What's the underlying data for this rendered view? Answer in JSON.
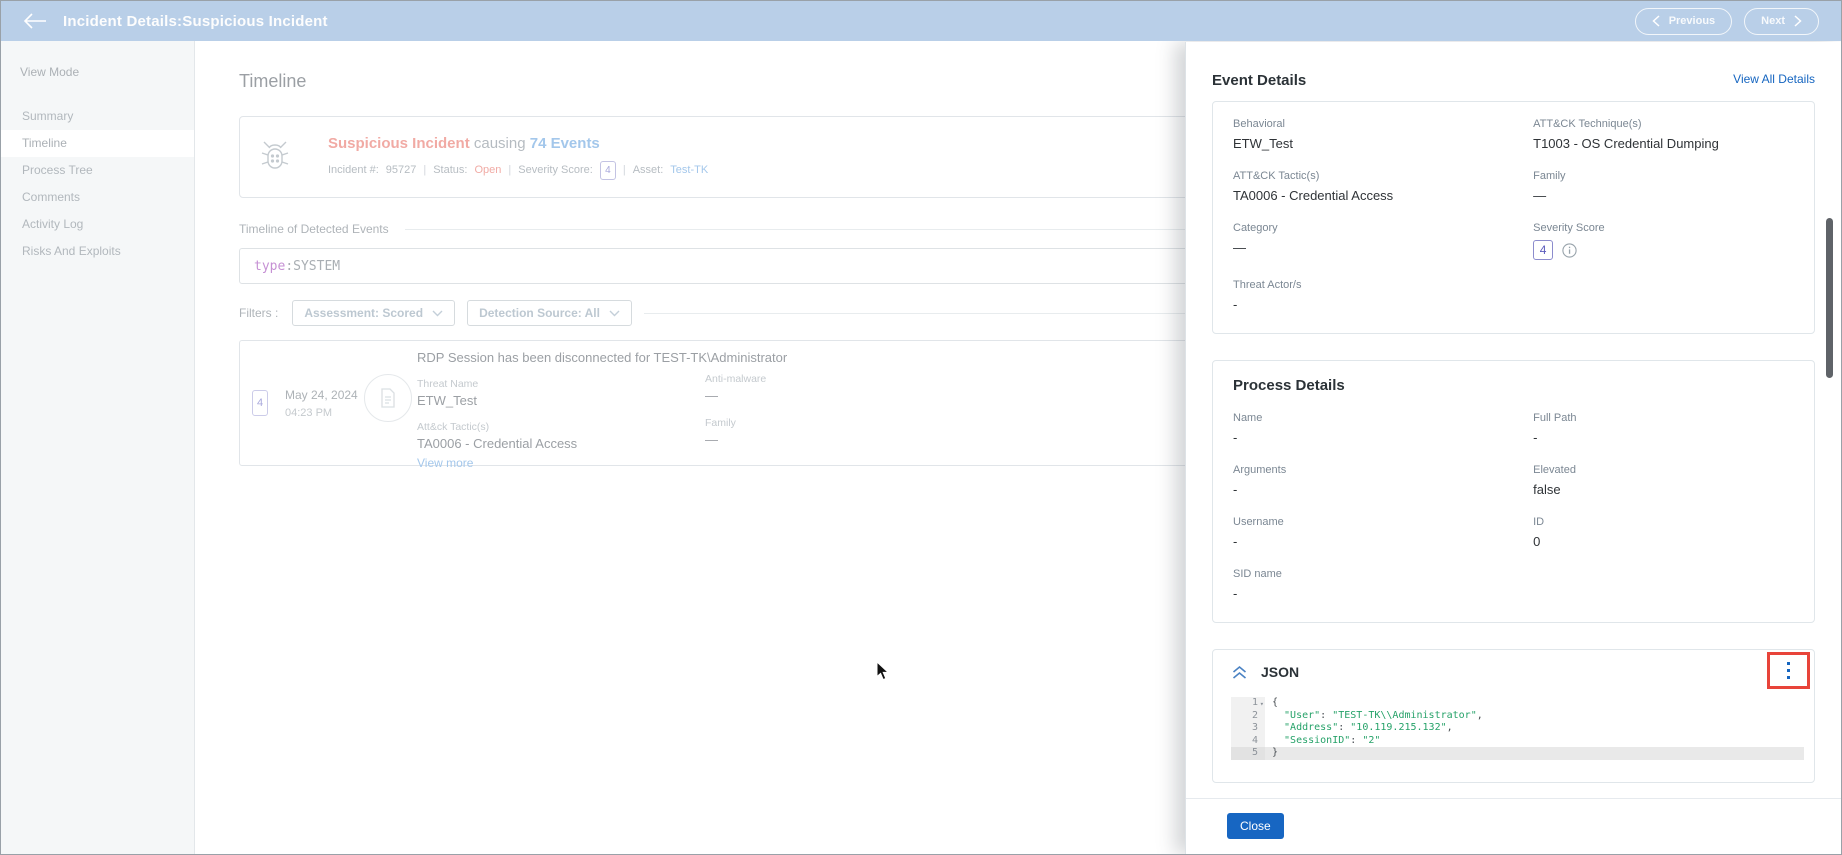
{
  "header": {
    "title": "Incident Details:Suspicious Incident",
    "previous_label": "Previous",
    "next_label": "Next"
  },
  "sidebar": {
    "title": "View Mode",
    "items": [
      {
        "label": "Summary"
      },
      {
        "label": "Timeline"
      },
      {
        "label": "Process Tree"
      },
      {
        "label": "Comments"
      },
      {
        "label": "Activity Log"
      },
      {
        "label": "Risks And Exploits"
      }
    ]
  },
  "main": {
    "page_title": "Timeline",
    "incident_card": {
      "name": "Suspicious Incident",
      "connector": " causing ",
      "events": "74 Events",
      "incident_label": "Incident #:",
      "incident_value": "95727",
      "status_label": "Status:",
      "status_value": "Open",
      "severity_label": "Severity Score:",
      "severity_value": "4",
      "asset_label": "Asset:",
      "asset_value": "Test-TK",
      "separator": "|"
    },
    "section_label": "Timeline of Detected Events",
    "search": {
      "key": "type",
      "rest": ":SYSTEM"
    },
    "filters": {
      "label": "Filters :",
      "assessment": "Assessment: Scored",
      "detection_source": "Detection Source: All"
    },
    "event_card": {
      "severity": "4",
      "date": "May 24, 2024",
      "time": "04:23 PM",
      "title": "RDP Session has been disconnected for TEST-TK\\Administrator",
      "threat_name_label": "Threat Name",
      "threat_name": "ETW_Test",
      "tactic_label": "Att&ck Tactic(s)",
      "tactic": "TA0006 - Credential Access",
      "view_more": "View more",
      "antimalware_label": "Anti-malware",
      "antimalware": "—",
      "family_label": "Family",
      "family": "—"
    }
  },
  "panel": {
    "title": "Event Details",
    "view_all_label": "View All Details",
    "event_details": {
      "behavioral_label": "Behavioral",
      "behavioral": "ETW_Test",
      "technique_label": "ATT&CK Technique(s)",
      "technique": "T1003 - OS Credential Dumping",
      "tactic_label": "ATT&CK Tactic(s)",
      "tactic": "TA0006 - Credential Access",
      "family_label": "Family",
      "family": "—",
      "category_label": "Category",
      "category": "—",
      "severity_label": "Severity Score",
      "severity": "4",
      "threat_actor_label": "Threat Actor/s",
      "threat_actor": "-"
    },
    "process_details": {
      "title": "Process Details",
      "name_label": "Name",
      "name": "-",
      "full_path_label": "Full Path",
      "full_path": "-",
      "arguments_label": "Arguments",
      "arguments": "-",
      "elevated_label": "Elevated",
      "elevated": "false",
      "username_label": "Username",
      "username": "-",
      "id_label": "ID",
      "id": "0",
      "sid_label": "SID name",
      "sid": "-"
    },
    "json_section": {
      "title": "JSON",
      "lines": [
        {
          "num": "1",
          "fold": "▾",
          "open": "{"
        },
        {
          "num": "2",
          "key": "  \"User\"",
          "sep": ": ",
          "val": "\"TEST-TK\\\\Administrator\"",
          "end": ","
        },
        {
          "num": "3",
          "key": "  \"Address\"",
          "sep": ": ",
          "val": "\"10.119.215.132\"",
          "end": ","
        },
        {
          "num": "4",
          "key": "  \"SessionID\"",
          "sep": ": ",
          "val": "\"2\""
        },
        {
          "num": "5",
          "open": "}"
        },
        {
          "num": ""
        }
      ]
    },
    "close_label": "Close"
  },
  "colors": {
    "header_bg": "#b9cfe8",
    "accent_blue": "#1565c0",
    "link_blue": "#4a90d9",
    "alert_red": "#e4584c",
    "severity_purple": "#5b5bbd",
    "json_green": "#26a269",
    "highlight_red": "#e8443a"
  }
}
